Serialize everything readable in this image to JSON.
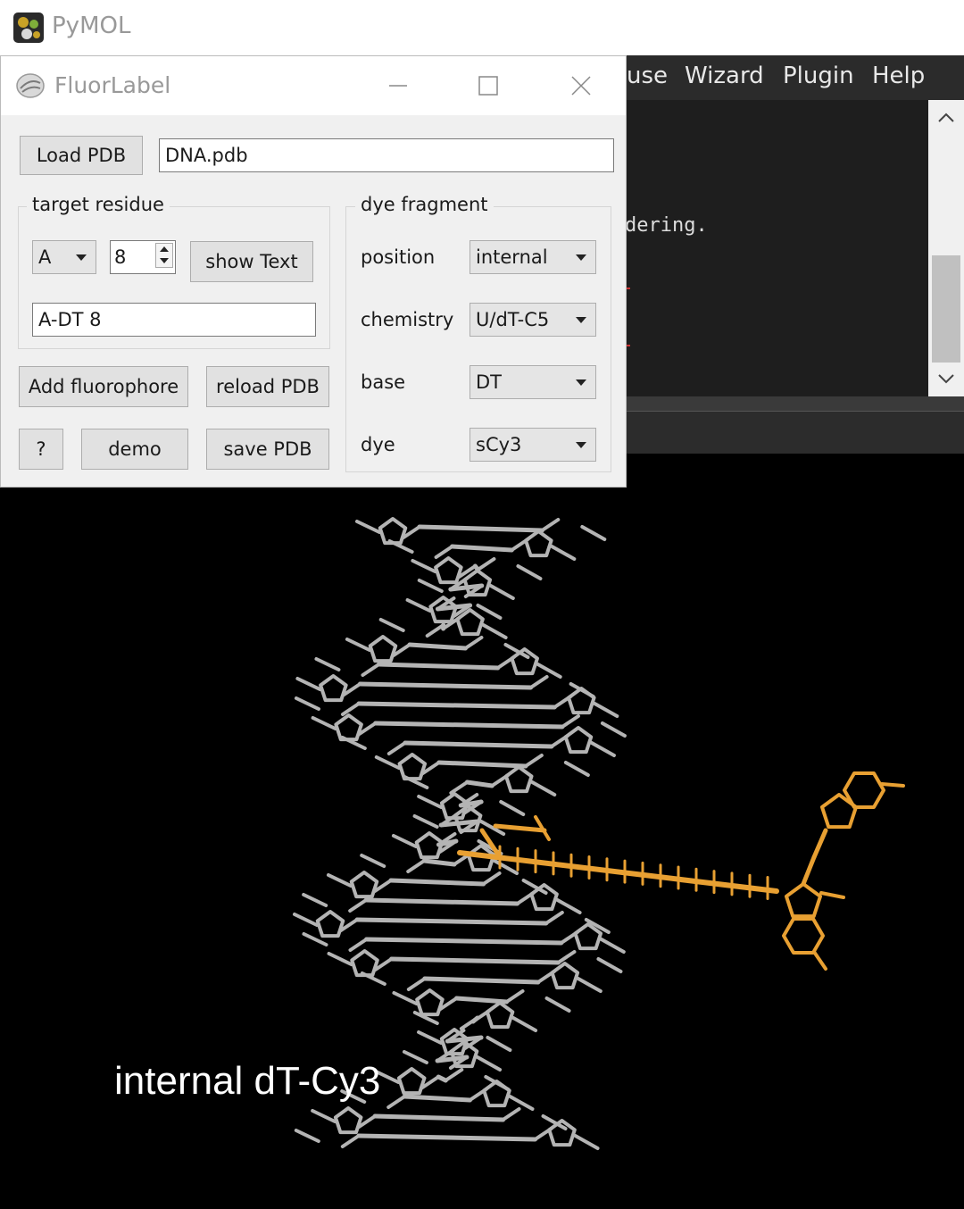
{
  "app": {
    "title": "PyMOL",
    "menu": [
      "use",
      "Wizard",
      "Plugin",
      "Help"
    ],
    "console_line": "dering."
  },
  "dialog": {
    "title": "FluorLabel",
    "load_pdb_label": "Load PDB",
    "pdb_file": "DNA.pdb",
    "target_residue": {
      "group_title": "target residue",
      "chain": "A",
      "residue_number": "8",
      "show_text_label": "show Text",
      "residue_label": "A-DT 8"
    },
    "add_fluorophore_label": "Add fluorophore",
    "reload_pdb_label": "reload PDB",
    "help_label": "?",
    "demo_label": "demo",
    "save_pdb_label": "save PDB",
    "dye_fragment": {
      "group_title": "dye fragment",
      "position_label": "position",
      "position_value": "internal",
      "chemistry_label": "chemistry",
      "chemistry_value": "U/dT-C5",
      "base_label": "base",
      "base_value": "DT",
      "dye_label": "dye",
      "dye_value": "sCy3"
    }
  },
  "viewer": {
    "caption": "internal dT-Cy3",
    "dna_color": "#b4b4b4",
    "dye_color": "#e8a032"
  }
}
